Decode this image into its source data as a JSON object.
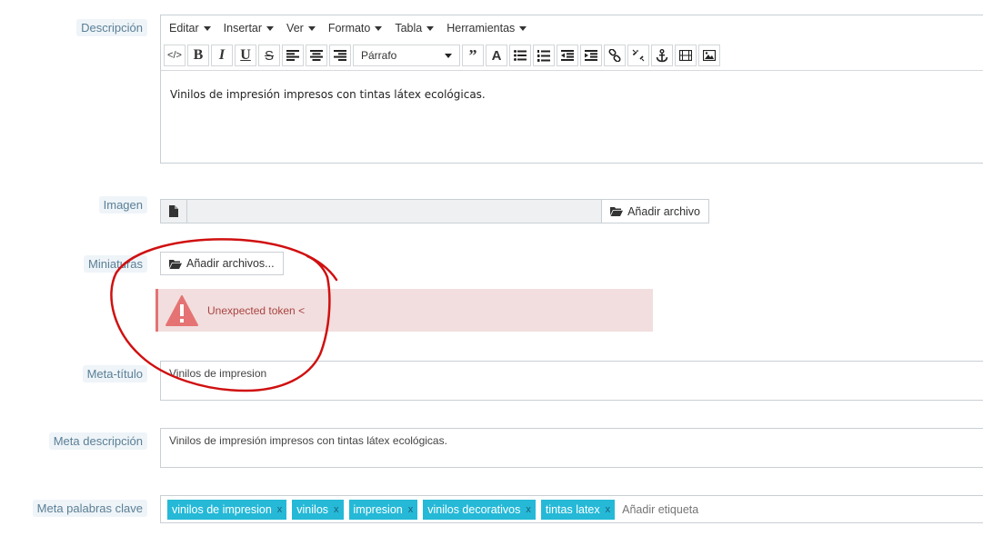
{
  "labels": {
    "descripcion": "Descripción",
    "imagen": "Imagen",
    "miniaturas": "Miniaturas",
    "meta_titulo": "Meta-título",
    "meta_descripcion": "Meta descripción",
    "meta_palabras": "Meta palabras clave"
  },
  "editor": {
    "menus": [
      "Editar",
      "Insertar",
      "Ver",
      "Formato",
      "Tabla",
      "Herramientas"
    ],
    "format_select": "Párrafo",
    "content": "Vinilos de impresión impresos con tintas látex ecológicas."
  },
  "imagen": {
    "button": "Añadir archivo"
  },
  "miniaturas": {
    "button": "Añadir archivos..."
  },
  "alert": {
    "text": "Unexpected token <"
  },
  "meta_titulo": {
    "value": "Vinilos de impresion"
  },
  "meta_descripcion": {
    "value": "Vinilos de impresión impresos con tintas látex ecológicas."
  },
  "tags": {
    "items": [
      "vinilos de impresion",
      "vinilos",
      "impresion",
      "vinilos decorativos",
      "tintas latex"
    ],
    "remove_glyph": "x",
    "placeholder": "Añadir etiqueta"
  },
  "colors": {
    "tag": "#25b9d7",
    "alert_bg": "#f2dede",
    "alert_text": "#a94442",
    "annotation": "#d01010"
  }
}
